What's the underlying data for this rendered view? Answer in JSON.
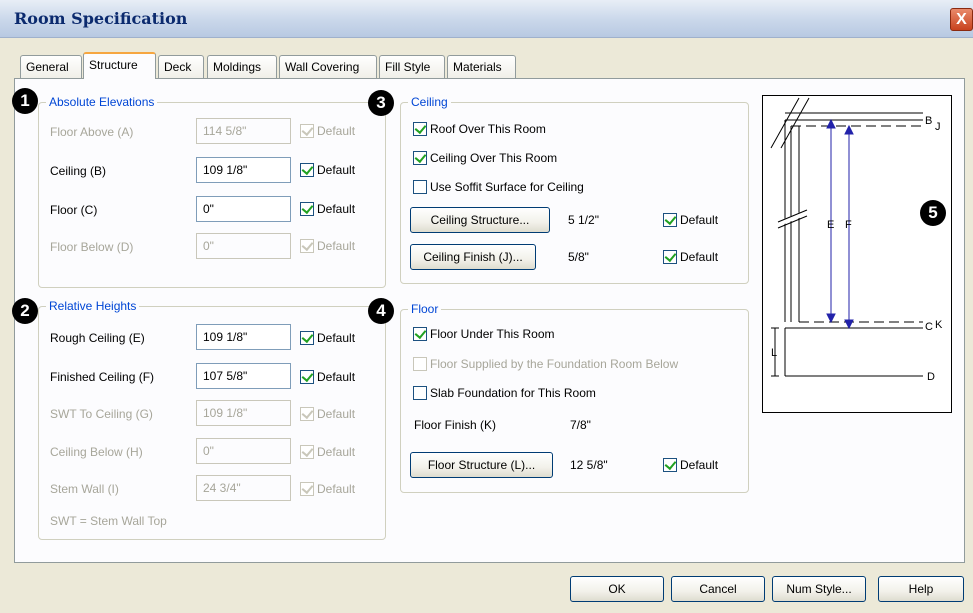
{
  "window": {
    "title": "Room Specification",
    "close": "X"
  },
  "tabs": [
    "General",
    "Structure",
    "Deck",
    "Moldings",
    "Wall Covering",
    "Fill Style",
    "Materials"
  ],
  "callouts": [
    "1",
    "2",
    "3",
    "4",
    "5"
  ],
  "absolute": {
    "title": "Absolute Elevations",
    "floor_above": {
      "label": "Floor Above (A)",
      "value": "114 5/8\"",
      "default": "Default"
    },
    "ceiling": {
      "label": "Ceiling (B)",
      "value": "109 1/8\"",
      "default": "Default"
    },
    "floor": {
      "label": "Floor (C)",
      "value": "0\"",
      "default": "Default"
    },
    "floor_below": {
      "label": "Floor Below (D)",
      "value": "0\"",
      "default": "Default"
    }
  },
  "relative": {
    "title": "Relative Heights",
    "rough_ceiling": {
      "label": "Rough Ceiling (E)",
      "value": "109 1/8\"",
      "default": "Default"
    },
    "finished_ceiling": {
      "label": "Finished Ceiling (F)",
      "value": "107 5/8\"",
      "default": "Default"
    },
    "swt_to_ceiling": {
      "label": "SWT To Ceiling (G)",
      "value": "109 1/8\"",
      "default": "Default"
    },
    "ceiling_below": {
      "label": "Ceiling Below (H)",
      "value": "0\"",
      "default": "Default"
    },
    "stem_wall": {
      "label": "Stem Wall (I)",
      "value": "24 3/4\"",
      "default": "Default"
    },
    "note": "SWT = Stem Wall Top"
  },
  "ceiling": {
    "title": "Ceiling",
    "roof_over": "Roof Over This Room",
    "ceiling_over": "Ceiling Over This Room",
    "soffit": "Use Soffit Surface for Ceiling",
    "structure_button": "Ceiling Structure...",
    "structure_value": "5 1/2\"",
    "structure_default": "Default",
    "finish_button": "Ceiling Finish (J)...",
    "finish_value": "5/8\"",
    "finish_default": "Default"
  },
  "floor": {
    "title": "Floor",
    "floor_under": "Floor Under This Room",
    "foundation_supplied": "Floor Supplied by the Foundation Room Below",
    "slab": "Slab Foundation for This Room",
    "finish_label": "Floor Finish (K)",
    "finish_value": "7/8\"",
    "structure_button": "Floor Structure (L)...",
    "structure_value": "12 5/8\"",
    "structure_default": "Default"
  },
  "diagram_labels": {
    "b": "B",
    "j": "J",
    "e": "E",
    "f": "F",
    "c": "C",
    "k": "K",
    "l": "L",
    "d": "D"
  },
  "footer": {
    "ok": "OK",
    "cancel": "Cancel",
    "num_style": "Num Style...",
    "help": "Help"
  }
}
